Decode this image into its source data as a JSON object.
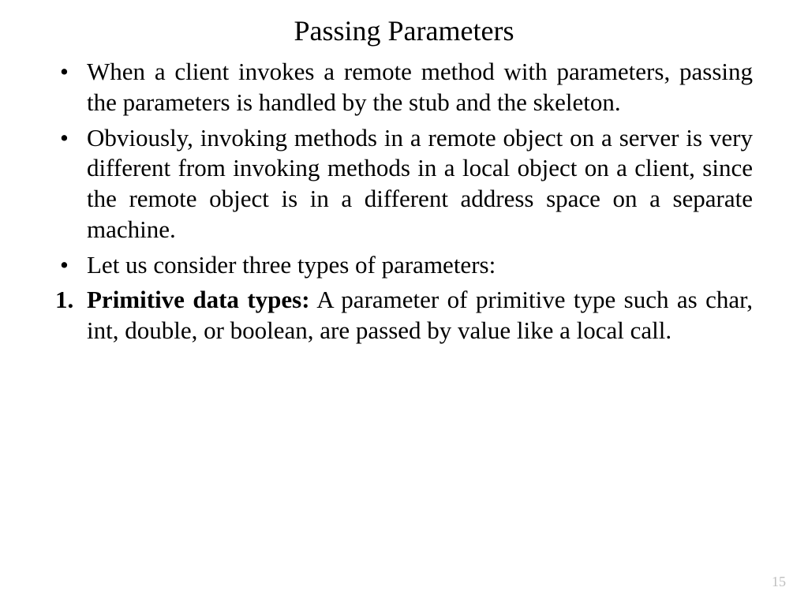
{
  "title": "Passing Parameters",
  "bullets": [
    "When a client invokes a remote method with parameters, passing the parameters is handled by the stub and the skeleton.",
    "Obviously, invoking methods in a remote object on a server is very different from invoking methods in a local object on a client, since the remote object is in a different address space on a separate machine.",
    "Let us consider three types of parameters:"
  ],
  "numbered": {
    "lead": "Primitive data types:",
    "rest": " A parameter of primitive type such as char, int, double, or boolean, are passed by value like a local call."
  },
  "page_number": "15"
}
